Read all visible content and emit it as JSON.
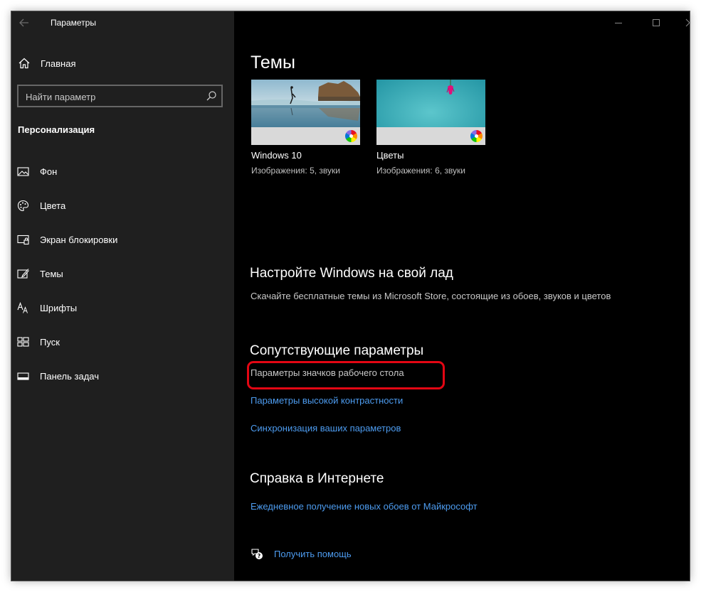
{
  "window": {
    "title": "Параметры",
    "icons": {
      "back": "back-arrow-icon",
      "minimize": "minimize-icon",
      "maximize": "maximize-icon",
      "close": "close-icon"
    }
  },
  "sidebar": {
    "home_label": "Главная",
    "search": {
      "placeholder": "Найти параметр",
      "value": ""
    },
    "section_title": "Персонализация",
    "items": [
      {
        "label": "Фон",
        "icon": "picture-icon"
      },
      {
        "label": "Цвета",
        "icon": "palette-icon"
      },
      {
        "label": "Экран блокировки",
        "icon": "lock-screen-icon"
      },
      {
        "label": "Темы",
        "icon": "themes-icon"
      },
      {
        "label": "Шрифты",
        "icon": "fonts-icon"
      },
      {
        "label": "Пуск",
        "icon": "start-icon"
      },
      {
        "label": "Панель задач",
        "icon": "taskbar-icon"
      }
    ]
  },
  "main": {
    "title": "Темы",
    "themes": [
      {
        "name": "Windows 10",
        "description": "Изображения: 5, звуки"
      },
      {
        "name": "Цветы",
        "description": "Изображения: 6, звуки"
      }
    ],
    "customize": {
      "heading": "Настройте Windows на свой лад",
      "text": "Скачайте бесплатные темы из Microsoft Store, состоящие из обоев, звуков и цветов"
    },
    "related": {
      "heading": "Сопутствующие параметры",
      "links": [
        "Параметры значков рабочего стола",
        "Параметры высокой контрастности",
        "Синхронизация ваших параметров"
      ]
    },
    "help": {
      "heading": "Справка в Интернете",
      "link": "Ежедневное получение новых обоев от Майкрософт",
      "get_help": "Получить помощь"
    }
  },
  "colors": {
    "sidebar_bg": "#1f1f1f",
    "main_bg": "#000000",
    "link": "#4d9cf0",
    "highlight": "#e30613"
  }
}
